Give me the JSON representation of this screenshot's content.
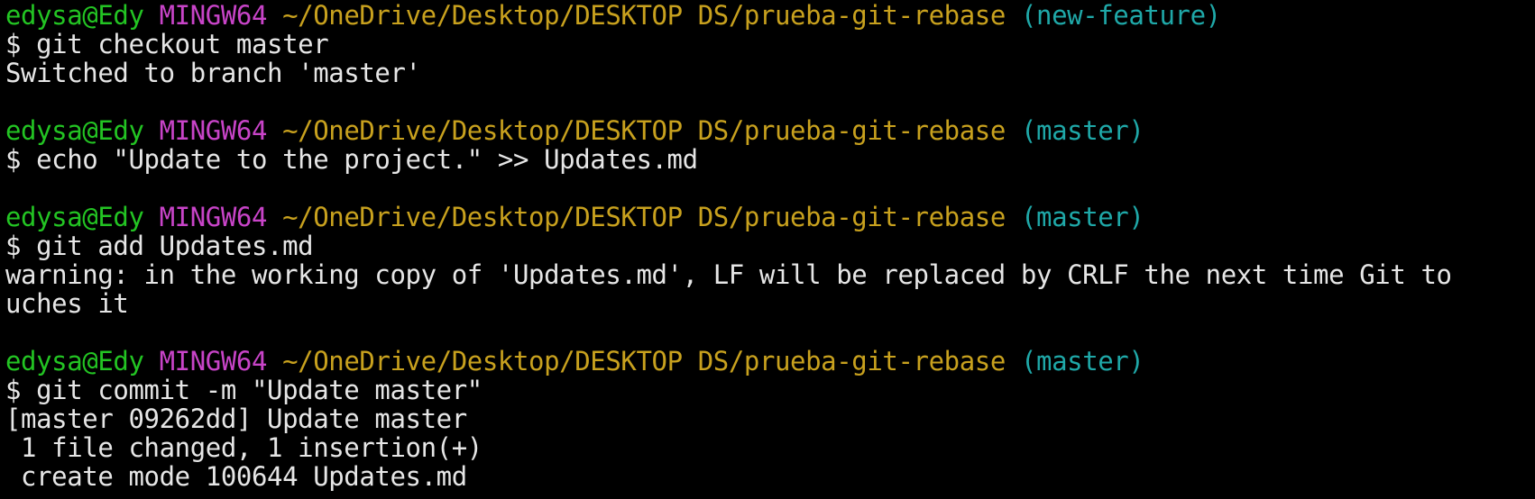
{
  "terminal": {
    "lines": [
      {
        "type": "prompt",
        "user": "edysa@Edy",
        "system": "MINGW64",
        "path": "~/OneDrive/Desktop/DESKTOP DS/prueba-git-rebase",
        "branch": "(new-feature)"
      },
      {
        "type": "command",
        "text": "$ git checkout master"
      },
      {
        "type": "output",
        "text": "Switched to branch 'master'"
      },
      {
        "type": "blank",
        "text": ""
      },
      {
        "type": "prompt",
        "user": "edysa@Edy",
        "system": "MINGW64",
        "path": "~/OneDrive/Desktop/DESKTOP DS/prueba-git-rebase",
        "branch": "(master)"
      },
      {
        "type": "command",
        "text": "$ echo \"Update to the project.\" >> Updates.md"
      },
      {
        "type": "blank",
        "text": ""
      },
      {
        "type": "prompt",
        "user": "edysa@Edy",
        "system": "MINGW64",
        "path": "~/OneDrive/Desktop/DESKTOP DS/prueba-git-rebase",
        "branch": "(master)"
      },
      {
        "type": "command",
        "text": "$ git add Updates.md"
      },
      {
        "type": "output",
        "text": "warning: in the working copy of 'Updates.md', LF will be replaced by CRLF the next time Git to"
      },
      {
        "type": "output",
        "text": "uches it"
      },
      {
        "type": "blank",
        "text": ""
      },
      {
        "type": "prompt",
        "user": "edysa@Edy",
        "system": "MINGW64",
        "path": "~/OneDrive/Desktop/DESKTOP DS/prueba-git-rebase",
        "branch": "(master)"
      },
      {
        "type": "command",
        "text": "$ git commit -m \"Update master\""
      },
      {
        "type": "output",
        "text": "[master 09262dd] Update master"
      },
      {
        "type": "output",
        "text": " 1 file changed, 1 insertion(+)"
      },
      {
        "type": "output",
        "text": " create mode 100644 Updates.md"
      }
    ]
  },
  "colors": {
    "background": "#000000",
    "user": "#23c423",
    "system": "#c844c8",
    "path": "#c8a11e",
    "branch": "#1fa8a8",
    "text": "#e6e6e6"
  }
}
